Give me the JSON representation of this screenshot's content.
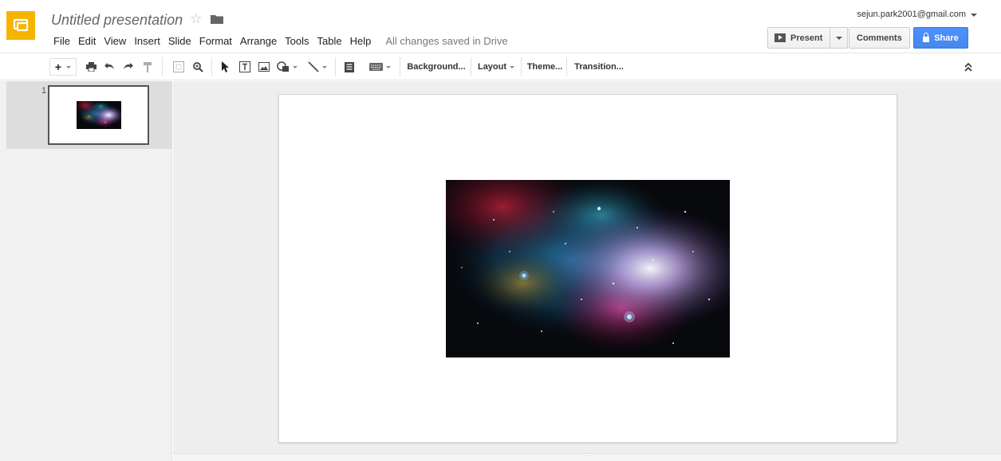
{
  "app": {
    "title": "Untitled presentation",
    "save_status": "All changes saved in Drive",
    "logo_color": "#f4b400"
  },
  "menu": [
    "File",
    "Edit",
    "View",
    "Insert",
    "Slide",
    "Format",
    "Arrange",
    "Tools",
    "Table",
    "Help"
  ],
  "account": {
    "email": "sejun.park2001@gmail.com"
  },
  "actions": {
    "present_label": "Present",
    "comments_label": "Comments",
    "share_label": "Share",
    "share_color": "#4d90fe"
  },
  "toolbar": {
    "background_label": "Background...",
    "layout_label": "Layout",
    "theme_label": "Theme...",
    "transition_label": "Transition..."
  },
  "slides": [
    {
      "number": "1",
      "content": "space-nebula-image"
    }
  ],
  "icons": [
    "app-logo-icon",
    "star-icon",
    "folder-icon",
    "present-icon",
    "lock-icon",
    "add-icon",
    "print-icon",
    "undo-icon",
    "redo-icon",
    "paint-format-icon",
    "zoom-fit-icon",
    "zoom-icon",
    "select-icon",
    "textbox-icon",
    "image-icon",
    "shape-icon",
    "line-icon",
    "comment-icon",
    "input-tools-icon",
    "collapse-icon"
  ]
}
